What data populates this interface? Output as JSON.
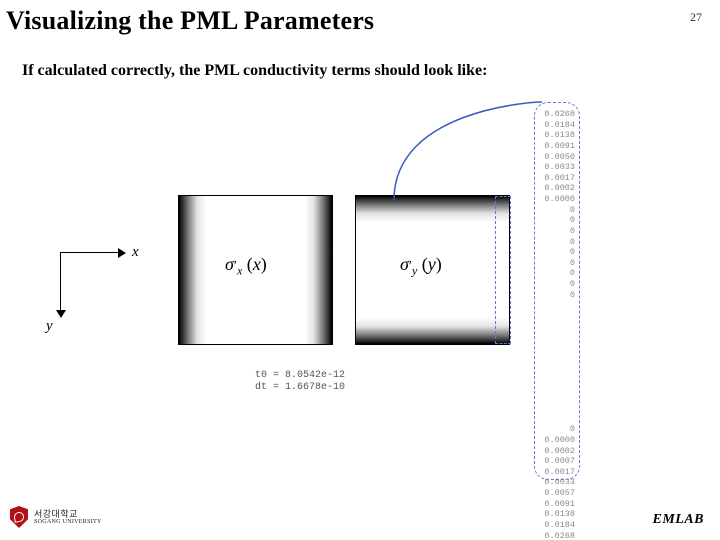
{
  "page_number": "27",
  "title": "Visualizing the PML Parameters",
  "subline": "If calculated correctly, the PML conductivity terms should look like:",
  "axis": {
    "x": "x",
    "y": "y"
  },
  "panels": {
    "sigma_x": "σ′ₓ(x)",
    "sigma_y": "σ′ᵧ(y)"
  },
  "readout": {
    "line1": "t0 = 8.0542e-12",
    "line2": "dt = 1.6678e-10"
  },
  "column_values_top": [
    "0.0268",
    "0.0184",
    "0.0138",
    "0.0091",
    "0.0050",
    "0.0033",
    "0.0017",
    "0.0002",
    "0.0000",
    "0",
    "0",
    "0",
    "0",
    "0",
    "0",
    "0",
    "0",
    "0"
  ],
  "column_values_bottom": [
    "0",
    "0.0000",
    "0.0002",
    "0.0007",
    "0.0017",
    "0.0033",
    "0.0057",
    "0.0091",
    "0.0138",
    "0.0184",
    "0.0268"
  ],
  "logo": {
    "kr": "서강대학교",
    "en": "SOGANG UNIVERSITY"
  },
  "lab": "EMLAB"
}
